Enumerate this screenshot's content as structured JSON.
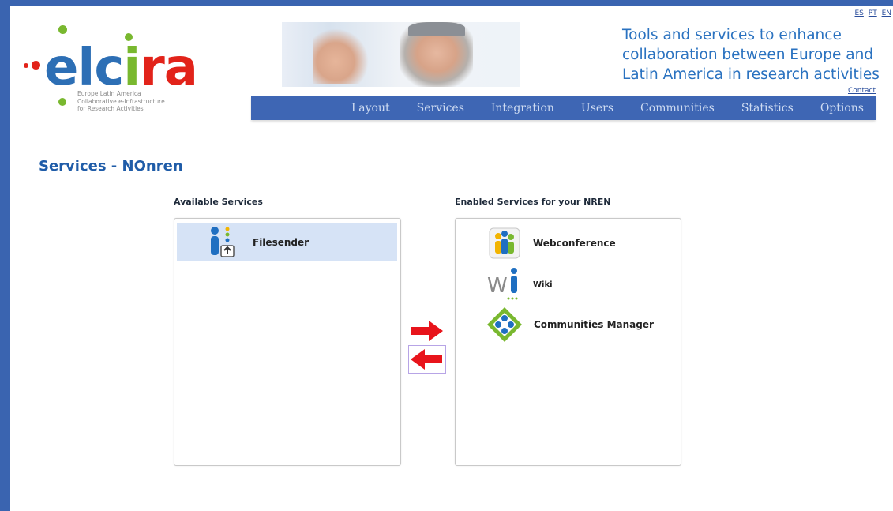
{
  "lang": [
    "ES",
    "PT",
    "EN"
  ],
  "logo": {
    "word": [
      "e",
      "l",
      "c",
      "i",
      "r",
      "a"
    ],
    "subtitle": [
      "Europe Latin America",
      "Collaborative e-Infrastructure",
      "for Research Activities"
    ]
  },
  "tagline": [
    "Tools and services to enhance",
    "collaboration between Europe and",
    "Latin America in research activities"
  ],
  "contact": "Contact",
  "nav": [
    "Layout",
    "Services",
    "Integration",
    "Users",
    "Communities",
    "Statistics",
    "Options"
  ],
  "page_title": "Services - NOnren",
  "available": {
    "label": "Available Services",
    "items": [
      {
        "label": "Filesender",
        "icon": "filesender-icon",
        "selected": true
      }
    ]
  },
  "enabled": {
    "label": "Enabled Services for your NREN",
    "items": [
      {
        "label": "Webconference",
        "icon": "webconference-icon"
      },
      {
        "label": "Wiki",
        "icon": "wiki-icon"
      },
      {
        "label": "Communities Manager",
        "icon": "communities-manager-icon"
      }
    ]
  },
  "colors": {
    "frame": "#3a64b0",
    "nav": "#3e66b4",
    "title": "#1f5ca8",
    "arrow": "#e8141b",
    "selected": "#d6e3f6"
  }
}
